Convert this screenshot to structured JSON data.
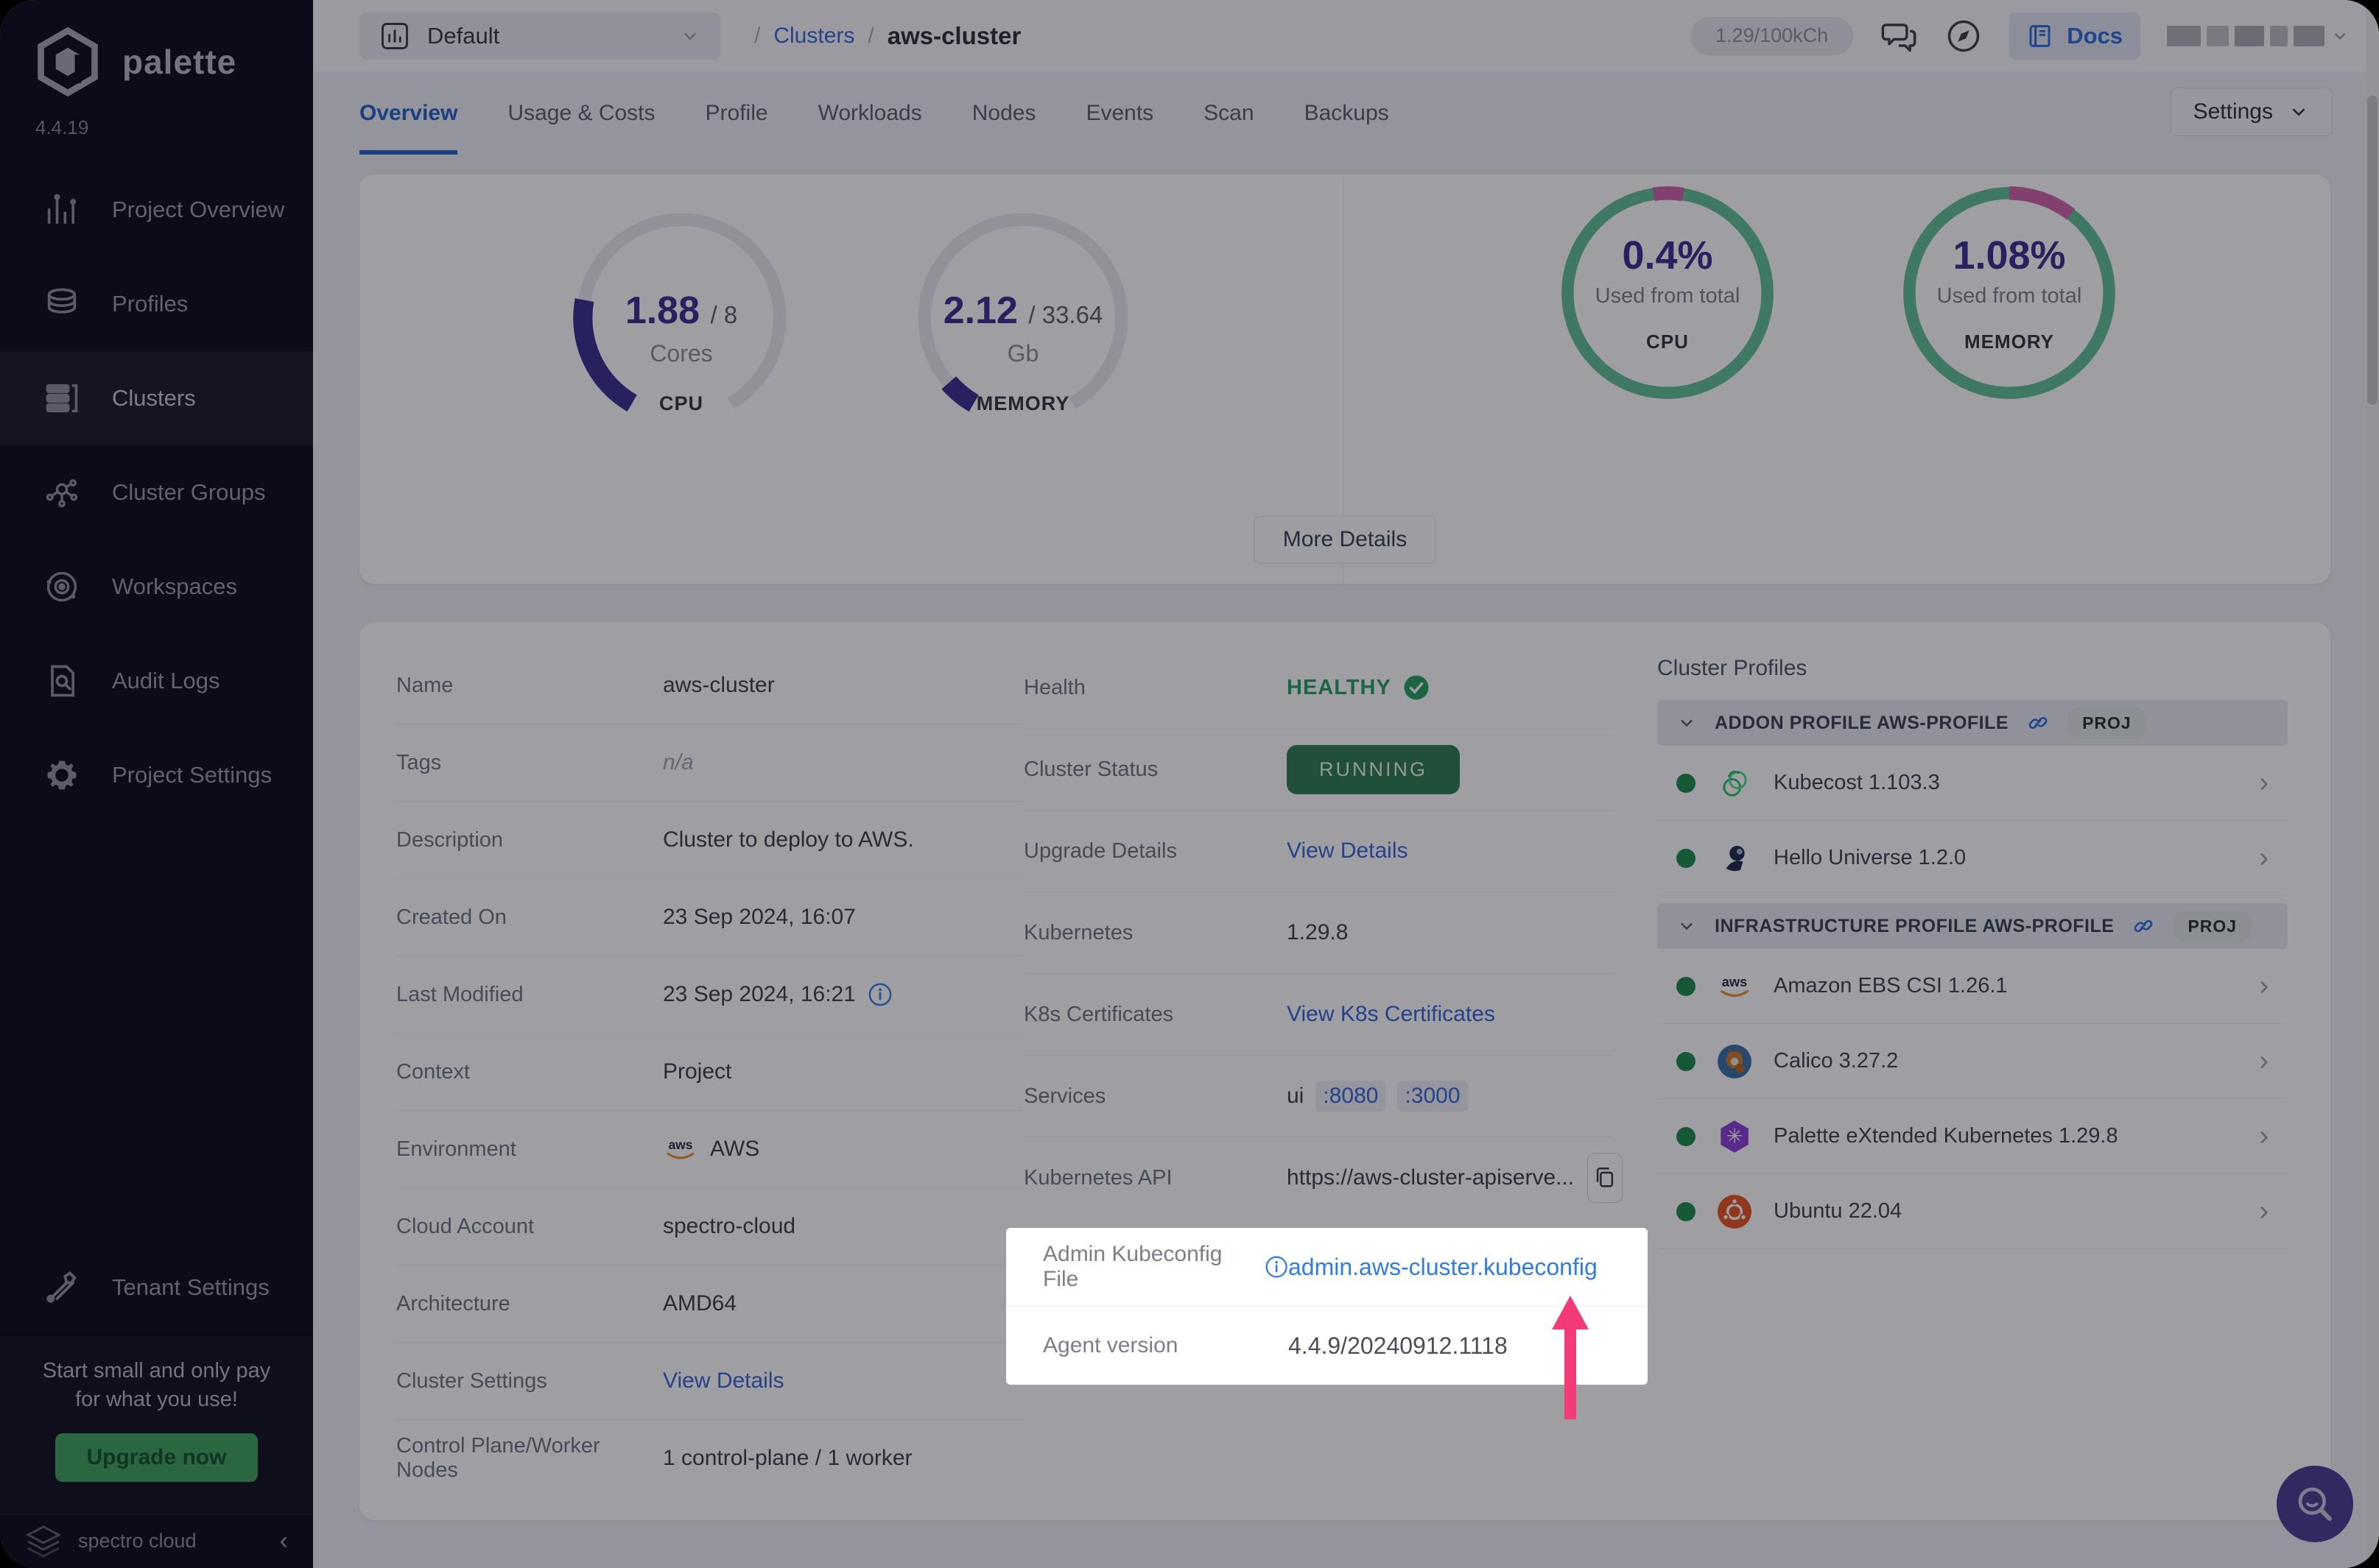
{
  "app": {
    "brand": "palette",
    "version": "4.4.19"
  },
  "sidebar": {
    "items": [
      {
        "label": "Project Overview",
        "icon": "chart-bars",
        "active": false
      },
      {
        "label": "Profiles",
        "icon": "layers",
        "active": false
      },
      {
        "label": "Clusters",
        "icon": "servers",
        "active": true
      },
      {
        "label": "Cluster Groups",
        "icon": "network",
        "active": false
      },
      {
        "label": "Workspaces",
        "icon": "orbit",
        "active": false
      },
      {
        "label": "Audit Logs",
        "icon": "doc-search",
        "active": false
      },
      {
        "label": "Project Settings",
        "icon": "gear",
        "active": false
      }
    ],
    "tenant": {
      "label": "Tenant Settings",
      "icon": "tools"
    },
    "promo": {
      "line1": "Start small and only pay",
      "line2": "for what you use!",
      "button": "Upgrade now"
    },
    "footer": {
      "brand": "spectro cloud"
    }
  },
  "topbar": {
    "project_selector": "Default",
    "breadcrumb": {
      "sep": "/",
      "link": "Clusters",
      "current": "aws-cluster"
    },
    "usage_pill": "1.29/100kCh",
    "docs_label": "Docs"
  },
  "tabs": {
    "items": [
      "Overview",
      "Usage & Costs",
      "Profile",
      "Workloads",
      "Nodes",
      "Events",
      "Scan",
      "Backups"
    ],
    "active": 0
  },
  "settings_button": "Settings",
  "metrics": {
    "cpu_gauge": {
      "value": "1.88",
      "total": "/ 8",
      "unit": "Cores",
      "label": "CPU",
      "fraction": 0.235
    },
    "memory_gauge": {
      "value": "2.12",
      "total": "/ 33.64",
      "unit": "Gb",
      "label": "MEMORY",
      "fraction": 0.063
    },
    "cpu_usage": {
      "pct": "0.4%",
      "caption": "Used from total",
      "label": "CPU",
      "pink_start": 262,
      "pink_sweep": 17
    },
    "memory_usage": {
      "pct": "1.08%",
      "caption": "Used from total",
      "label": "MEMORY",
      "pink_start": 270,
      "pink_sweep": 38
    },
    "more_details": "More Details"
  },
  "details": {
    "rows": [
      {
        "label": "Name",
        "value": "aws-cluster",
        "type": "text"
      },
      {
        "label": "Tags",
        "value": "n/a",
        "type": "muted"
      },
      {
        "label": "Description",
        "value": "Cluster to deploy to AWS.",
        "type": "text"
      },
      {
        "label": "Created On",
        "value": "23 Sep 2024, 16:07",
        "type": "text"
      },
      {
        "label": "Last Modified",
        "value": "23 Sep 2024, 16:21",
        "type": "text",
        "info": true
      },
      {
        "label": "Context",
        "value": "Project",
        "type": "text"
      },
      {
        "label": "Environment",
        "value": "AWS",
        "type": "aws"
      },
      {
        "label": "Cloud Account",
        "value": "spectro-cloud",
        "type": "text"
      },
      {
        "label": "Architecture",
        "value": "AMD64",
        "type": "text"
      },
      {
        "label": "Cluster Settings",
        "value": "View Details",
        "type": "link"
      },
      {
        "label": "Control Plane/Worker Nodes",
        "value": "1 control-plane / 1 worker",
        "type": "text"
      }
    ]
  },
  "status": {
    "rows": [
      {
        "label": "Health",
        "value": "HEALTHY",
        "type": "health"
      },
      {
        "label": "Cluster Status",
        "value": "RUNNING",
        "type": "pill"
      },
      {
        "label": "Upgrade Details",
        "value": "View Details",
        "type": "link"
      },
      {
        "label": "Kubernetes",
        "value": "1.29.8",
        "type": "text"
      },
      {
        "label": "K8s Certificates",
        "value": "View K8s Certificates",
        "type": "link"
      },
      {
        "label": "Services",
        "value": "ui",
        "ports": [
          ":8080",
          ":3000"
        ],
        "type": "services"
      },
      {
        "label": "Kubernetes API",
        "value": "https://aws-cluster-apiserve...",
        "type": "api"
      }
    ]
  },
  "spotlight": {
    "rows": [
      {
        "label": "Admin Kubeconfig File",
        "value": "admin.aws-cluster.kubeconfig"
      },
      {
        "label": "Agent version",
        "value": "4.4.9/20240912.1118"
      }
    ]
  },
  "profiles": {
    "title": "Cluster Profiles",
    "sections": [
      {
        "name": "ADDON PROFILE AWS-PROFILE",
        "badge": "PROJ",
        "items": [
          {
            "name": "Kubecost 1.103.3",
            "icon": "kubecost"
          },
          {
            "name": "Hello Universe 1.2.0",
            "icon": "hello-universe"
          }
        ]
      },
      {
        "name": "INFRASTRUCTURE PROFILE AWS-PROFILE",
        "badge": "PROJ",
        "items": [
          {
            "name": "Amazon EBS CSI 1.26.1",
            "icon": "aws"
          },
          {
            "name": "Calico 3.27.2",
            "icon": "calico"
          },
          {
            "name": "Palette eXtended Kubernetes 1.29.8",
            "icon": "pxk"
          },
          {
            "name": "Ubuntu 22.04",
            "icon": "ubuntu"
          }
        ]
      }
    ]
  },
  "colors": {
    "accent_blue": "#3568d4",
    "status_green": "#2e7d4f",
    "ring_green": "#62c195",
    "ring_pink": "#cf63a6",
    "indigo": "#3b2f8f",
    "arrow_pink": "#f23b77"
  }
}
